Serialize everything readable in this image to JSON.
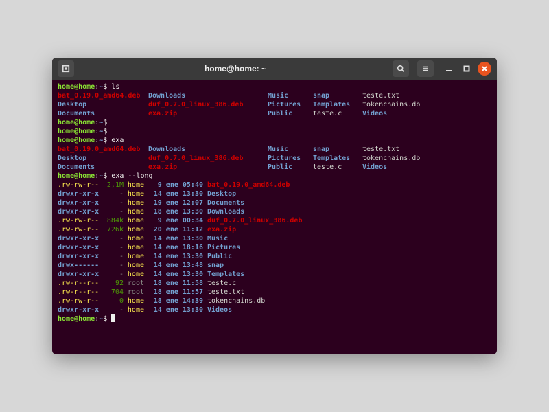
{
  "window": {
    "title": "home@home: ~"
  },
  "prompt": {
    "user_host": "home@home",
    "path": "~",
    "sep1": ":",
    "sep2": "$"
  },
  "commands": {
    "ls": "ls",
    "empty": "",
    "exa": "exa",
    "exa_long": "exa --long"
  },
  "ls_rows": [
    [
      {
        "t": "bat_0.19.0_amd64.deb",
        "c": "red"
      },
      {
        "t": "Downloads",
        "c": "blue"
      },
      {
        "t": "Music",
        "c": "blue"
      },
      {
        "t": "snap",
        "c": "blue"
      },
      {
        "t": "teste.txt",
        "c": "white"
      }
    ],
    [
      {
        "t": "Desktop",
        "c": "blue"
      },
      {
        "t": "duf_0.7.0_linux_386.deb",
        "c": "red"
      },
      {
        "t": "Pictures",
        "c": "blue"
      },
      {
        "t": "Templates",
        "c": "blue"
      },
      {
        "t": "tokenchains.db",
        "c": "white"
      }
    ],
    [
      {
        "t": "Documents",
        "c": "blue"
      },
      {
        "t": "exa.zip",
        "c": "red"
      },
      {
        "t": "Public",
        "c": "blue"
      },
      {
        "t": "teste.c",
        "c": "white"
      },
      {
        "t": "Videos",
        "c": "blue"
      }
    ]
  ],
  "long_rows": [
    {
      "perm": ".rw-rw-r--",
      "pc": "yellow",
      "size": "2,1M",
      "sc": "green",
      "user": "home",
      "uc": "yellow",
      "date": " 9 ene 05:40",
      "name": "bat_0.19.0_amd64.deb",
      "nc": "red"
    },
    {
      "perm": "drwxr-xr-x",
      "pc": "blue",
      "size": "-",
      "sc": "grey",
      "user": "home",
      "uc": "yellow",
      "date": "14 ene 13:30",
      "name": "Desktop",
      "nc": "blue"
    },
    {
      "perm": "drwxr-xr-x",
      "pc": "blue",
      "size": "-",
      "sc": "grey",
      "user": "home",
      "uc": "yellow",
      "date": "19 ene 12:07",
      "name": "Documents",
      "nc": "blue"
    },
    {
      "perm": "drwxr-xr-x",
      "pc": "blue",
      "size": "-",
      "sc": "grey",
      "user": "home",
      "uc": "yellow",
      "date": "18 ene 13:30",
      "name": "Downloads",
      "nc": "blue"
    },
    {
      "perm": ".rw-rw-r--",
      "pc": "yellow",
      "size": "884k",
      "sc": "green",
      "user": "home",
      "uc": "yellow",
      "date": " 9 ene 00:34",
      "name": "duf_0.7.0_linux_386.deb",
      "nc": "red"
    },
    {
      "perm": ".rw-rw-r--",
      "pc": "yellow",
      "size": "726k",
      "sc": "green",
      "user": "home",
      "uc": "yellow",
      "date": "20 ene 11:12",
      "name": "exa.zip",
      "nc": "red"
    },
    {
      "perm": "drwxr-xr-x",
      "pc": "blue",
      "size": "-",
      "sc": "grey",
      "user": "home",
      "uc": "yellow",
      "date": "14 ene 13:30",
      "name": "Music",
      "nc": "blue"
    },
    {
      "perm": "drwxr-xr-x",
      "pc": "blue",
      "size": "-",
      "sc": "grey",
      "user": "home",
      "uc": "yellow",
      "date": "14 ene 18:16",
      "name": "Pictures",
      "nc": "blue"
    },
    {
      "perm": "drwxr-xr-x",
      "pc": "blue",
      "size": "-",
      "sc": "grey",
      "user": "home",
      "uc": "yellow",
      "date": "14 ene 13:30",
      "name": "Public",
      "nc": "blue"
    },
    {
      "perm": "drwx------",
      "pc": "blue",
      "size": "-",
      "sc": "grey",
      "user": "home",
      "uc": "yellow",
      "date": "14 ene 13:48",
      "name": "snap",
      "nc": "blue"
    },
    {
      "perm": "drwxr-xr-x",
      "pc": "blue",
      "size": "-",
      "sc": "grey",
      "user": "home",
      "uc": "yellow",
      "date": "14 ene 13:30",
      "name": "Templates",
      "nc": "blue"
    },
    {
      "perm": ".rw-r--r--",
      "pc": "yellow",
      "size": "92",
      "sc": "green",
      "user": "root",
      "uc": "grey",
      "date": "18 ene 11:58",
      "name": "teste.c",
      "nc": "white"
    },
    {
      "perm": ".rw-r--r--",
      "pc": "yellow",
      "size": "704",
      "sc": "green",
      "user": "root",
      "uc": "grey",
      "date": "18 ene 11:57",
      "name": "teste.txt",
      "nc": "white"
    },
    {
      "perm": ".rw-rw-r--",
      "pc": "yellow",
      "size": "0",
      "sc": "green",
      "user": "home",
      "uc": "yellow",
      "date": "18 ene 14:39",
      "name": "tokenchains.db",
      "nc": "white"
    },
    {
      "perm": "drwxr-xr-x",
      "pc": "blue",
      "size": "-",
      "sc": "grey",
      "user": "home",
      "uc": "yellow",
      "date": "14 ene 13:30",
      "name": "Videos",
      "nc": "blue"
    }
  ]
}
